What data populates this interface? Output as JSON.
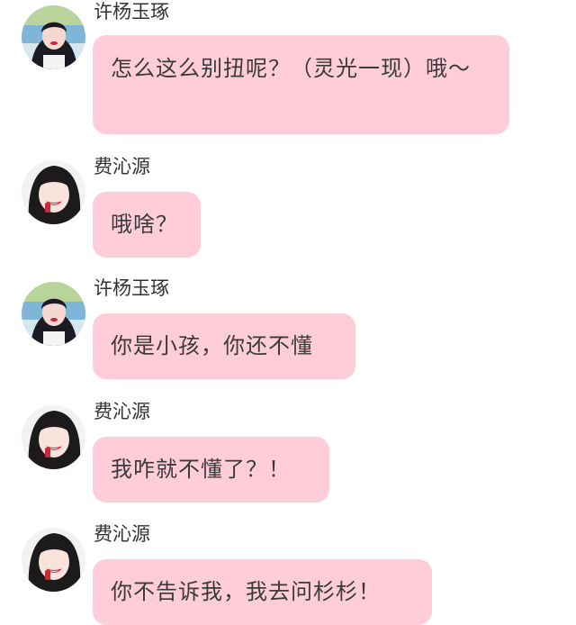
{
  "messages": [
    {
      "sender": "许杨玉琢",
      "avatar_icon": "girl-red-lips-avatar",
      "text": "怎么这么别扭呢？（灵光一现）哦～"
    },
    {
      "sender": "费沁源",
      "avatar_icon": "girl-smiling-avatar",
      "text": "哦啥？"
    },
    {
      "sender": "许杨玉琢",
      "avatar_icon": "girl-red-lips-avatar",
      "text": "你是小孩，你还不懂"
    },
    {
      "sender": "费沁源",
      "avatar_icon": "girl-smiling-avatar",
      "text": "我咋就不懂了？！"
    },
    {
      "sender": "费沁源",
      "avatar_icon": "girl-smiling-avatar",
      "text": "你不告诉我，我去问杉杉！"
    }
  ],
  "colors": {
    "bubble": "#ffcdd9",
    "text": "#3a3a3a",
    "name": "#333333",
    "background": "#ffffff"
  }
}
